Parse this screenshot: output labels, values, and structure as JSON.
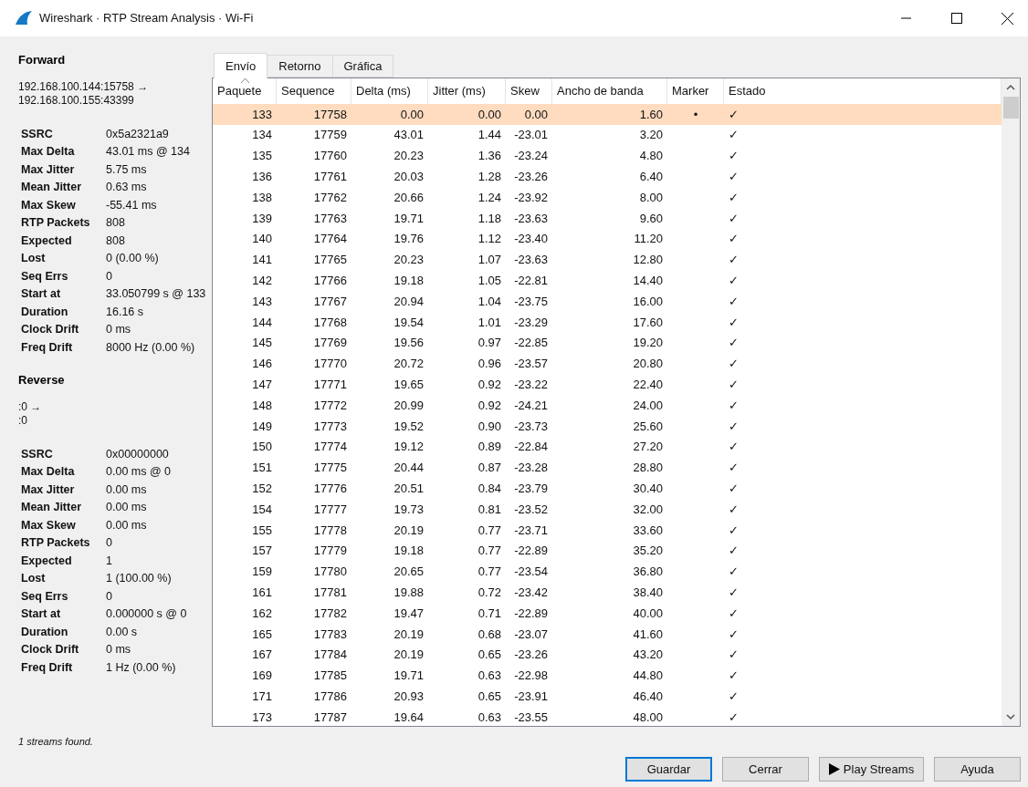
{
  "window": {
    "title": "Wireshark · RTP Stream Analysis · Wi-Fi"
  },
  "streams": [
    {
      "heading": "Forward",
      "endpoints": [
        "192.168.100.144:15758 →",
        "192.168.100.155:43399"
      ],
      "stats": [
        {
          "label": "SSRC",
          "value": "0x5a2321a9"
        },
        {
          "label": "Max Delta",
          "value": "43.01 ms @ 134"
        },
        {
          "label": "Max Jitter",
          "value": "5.75 ms"
        },
        {
          "label": "Mean Jitter",
          "value": "0.63 ms"
        },
        {
          "label": "Max Skew",
          "value": "-55.41 ms"
        },
        {
          "label": "RTP Packets",
          "value": "808"
        },
        {
          "label": "Expected",
          "value": "808"
        },
        {
          "label": "Lost",
          "value": "0 (0.00 %)"
        },
        {
          "label": "Seq Errs",
          "value": "0"
        },
        {
          "label": "Start at",
          "value": "33.050799 s @ 133"
        },
        {
          "label": "Duration",
          "value": "16.16 s"
        },
        {
          "label": "Clock Drift",
          "value": "0 ms"
        },
        {
          "label": "Freq Drift",
          "value": "8000 Hz (0.00 %)"
        }
      ]
    },
    {
      "heading": "Reverse",
      "endpoints": [
        ":0 →",
        ":0"
      ],
      "stats": [
        {
          "label": "SSRC",
          "value": "0x00000000"
        },
        {
          "label": "Max Delta",
          "value": "0.00 ms @ 0"
        },
        {
          "label": "Max Jitter",
          "value": "0.00 ms"
        },
        {
          "label": "Mean Jitter",
          "value": "0.00 ms"
        },
        {
          "label": "Max Skew",
          "value": "0.00 ms"
        },
        {
          "label": "RTP Packets",
          "value": "0"
        },
        {
          "label": "Expected",
          "value": "1"
        },
        {
          "label": "Lost",
          "value": "1 (100.00 %)"
        },
        {
          "label": "Seq Errs",
          "value": "0"
        },
        {
          "label": "Start at",
          "value": "0.000000 s @ 0"
        },
        {
          "label": "Duration",
          "value": "0.00 s"
        },
        {
          "label": "Clock Drift",
          "value": "0 ms"
        },
        {
          "label": "Freq Drift",
          "value": "1 Hz (0.00 %)"
        }
      ]
    }
  ],
  "status": "1 streams found.",
  "tabs": [
    {
      "label": "Envío",
      "selected": true
    },
    {
      "label": "Retorno",
      "selected": false
    },
    {
      "label": "Gráfica",
      "selected": false
    }
  ],
  "table": {
    "columns": [
      "Paquete",
      "Sequence",
      "Delta (ms)",
      "Jitter (ms)",
      "Skew",
      "Ancho de banda",
      "Marker",
      "Estado"
    ],
    "rows": [
      {
        "cells": [
          "133",
          "17758",
          "0.00",
          "0.00",
          "0.00",
          "1.60",
          "•",
          "✓"
        ],
        "selected": true
      },
      {
        "cells": [
          "134",
          "17759",
          "43.01",
          "1.44",
          "-23.01",
          "3.20",
          "",
          "✓"
        ],
        "selected": false
      },
      {
        "cells": [
          "135",
          "17760",
          "20.23",
          "1.36",
          "-23.24",
          "4.80",
          "",
          "✓"
        ],
        "selected": false
      },
      {
        "cells": [
          "136",
          "17761",
          "20.03",
          "1.28",
          "-23.26",
          "6.40",
          "",
          "✓"
        ],
        "selected": false
      },
      {
        "cells": [
          "138",
          "17762",
          "20.66",
          "1.24",
          "-23.92",
          "8.00",
          "",
          "✓"
        ],
        "selected": false
      },
      {
        "cells": [
          "139",
          "17763",
          "19.71",
          "1.18",
          "-23.63",
          "9.60",
          "",
          "✓"
        ],
        "selected": false
      },
      {
        "cells": [
          "140",
          "17764",
          "19.76",
          "1.12",
          "-23.40",
          "11.20",
          "",
          "✓"
        ],
        "selected": false
      },
      {
        "cells": [
          "141",
          "17765",
          "20.23",
          "1.07",
          "-23.63",
          "12.80",
          "",
          "✓"
        ],
        "selected": false
      },
      {
        "cells": [
          "142",
          "17766",
          "19.18",
          "1.05",
          "-22.81",
          "14.40",
          "",
          "✓"
        ],
        "selected": false
      },
      {
        "cells": [
          "143",
          "17767",
          "20.94",
          "1.04",
          "-23.75",
          "16.00",
          "",
          "✓"
        ],
        "selected": false
      },
      {
        "cells": [
          "144",
          "17768",
          "19.54",
          "1.01",
          "-23.29",
          "17.60",
          "",
          "✓"
        ],
        "selected": false
      },
      {
        "cells": [
          "145",
          "17769",
          "19.56",
          "0.97",
          "-22.85",
          "19.20",
          "",
          "✓"
        ],
        "selected": false
      },
      {
        "cells": [
          "146",
          "17770",
          "20.72",
          "0.96",
          "-23.57",
          "20.80",
          "",
          "✓"
        ],
        "selected": false
      },
      {
        "cells": [
          "147",
          "17771",
          "19.65",
          "0.92",
          "-23.22",
          "22.40",
          "",
          "✓"
        ],
        "selected": false
      },
      {
        "cells": [
          "148",
          "17772",
          "20.99",
          "0.92",
          "-24.21",
          "24.00",
          "",
          "✓"
        ],
        "selected": false
      },
      {
        "cells": [
          "149",
          "17773",
          "19.52",
          "0.90",
          "-23.73",
          "25.60",
          "",
          "✓"
        ],
        "selected": false
      },
      {
        "cells": [
          "150",
          "17774",
          "19.12",
          "0.89",
          "-22.84",
          "27.20",
          "",
          "✓"
        ],
        "selected": false
      },
      {
        "cells": [
          "151",
          "17775",
          "20.44",
          "0.87",
          "-23.28",
          "28.80",
          "",
          "✓"
        ],
        "selected": false
      },
      {
        "cells": [
          "152",
          "17776",
          "20.51",
          "0.84",
          "-23.79",
          "30.40",
          "",
          "✓"
        ],
        "selected": false
      },
      {
        "cells": [
          "154",
          "17777",
          "19.73",
          "0.81",
          "-23.52",
          "32.00",
          "",
          "✓"
        ],
        "selected": false
      },
      {
        "cells": [
          "155",
          "17778",
          "20.19",
          "0.77",
          "-23.71",
          "33.60",
          "",
          "✓"
        ],
        "selected": false
      },
      {
        "cells": [
          "157",
          "17779",
          "19.18",
          "0.77",
          "-22.89",
          "35.20",
          "",
          "✓"
        ],
        "selected": false
      },
      {
        "cells": [
          "159",
          "17780",
          "20.65",
          "0.77",
          "-23.54",
          "36.80",
          "",
          "✓"
        ],
        "selected": false
      },
      {
        "cells": [
          "161",
          "17781",
          "19.88",
          "0.72",
          "-23.42",
          "38.40",
          "",
          "✓"
        ],
        "selected": false
      },
      {
        "cells": [
          "162",
          "17782",
          "19.47",
          "0.71",
          "-22.89",
          "40.00",
          "",
          "✓"
        ],
        "selected": false
      },
      {
        "cells": [
          "165",
          "17783",
          "20.19",
          "0.68",
          "-23.07",
          "41.60",
          "",
          "✓"
        ],
        "selected": false
      },
      {
        "cells": [
          "167",
          "17784",
          "20.19",
          "0.65",
          "-23.26",
          "43.20",
          "",
          "✓"
        ],
        "selected": false
      },
      {
        "cells": [
          "169",
          "17785",
          "19.71",
          "0.63",
          "-22.98",
          "44.80",
          "",
          "✓"
        ],
        "selected": false
      },
      {
        "cells": [
          "171",
          "17786",
          "20.93",
          "0.65",
          "-23.91",
          "46.40",
          "",
          "✓"
        ],
        "selected": false
      },
      {
        "cells": [
          "173",
          "17787",
          "19.64",
          "0.63",
          "-23.55",
          "48.00",
          "",
          "✓"
        ],
        "selected": false
      }
    ]
  },
  "buttons": [
    {
      "label": "Guardar",
      "kind": "default"
    },
    {
      "label": "Cerrar",
      "kind": "plain"
    },
    {
      "label": "Play Streams",
      "kind": "play"
    },
    {
      "label": "Ayuda",
      "kind": "plain"
    }
  ]
}
